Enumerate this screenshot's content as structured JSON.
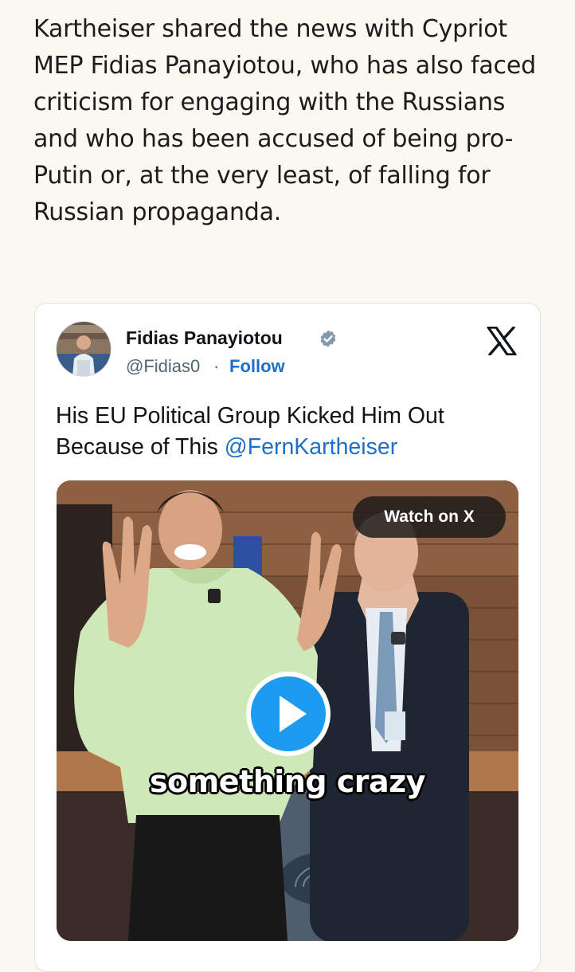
{
  "article": {
    "paragraph": "Kartheiser shared the news with Cypriot MEP Fidias Panayiotou, who has also faced criticism for engaging with the Russians and who has been accused of being pro-Putin or, at the very least, of falling for Russian propaganda."
  },
  "embed": {
    "author_name": "Fidias Panayiotou",
    "author_handle": "@Fidias0",
    "handle_separator": "·",
    "follow_label": "Follow",
    "tweet_text_main": "His EU Political Group Kicked Him Out Because of This ",
    "tweet_mention": "@FernKartheiser",
    "watch_label": "Watch on X",
    "video_caption": "something crazy",
    "icons": {
      "avatar": "avatar-photo",
      "verified": "verified-badge-icon",
      "platform": "x-logo-icon",
      "play": "play-icon"
    },
    "colors": {
      "link": "#1d6fc9",
      "text": "#0f1419",
      "muted": "#536471",
      "verified": "#829aab",
      "play": "#1d9bf0"
    }
  }
}
